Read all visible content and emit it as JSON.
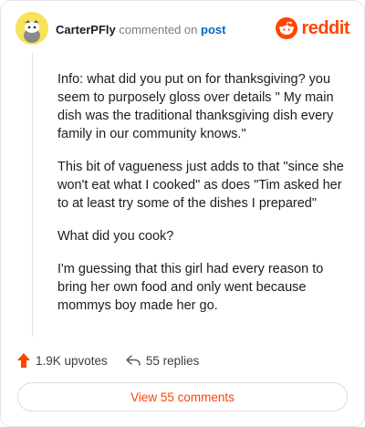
{
  "header": {
    "author": "CarterPFly",
    "action_text": "commented on",
    "post_link": "post",
    "brand": "reddit"
  },
  "comment": {
    "paragraphs": [
      "Info: what did you put on for thanksgiving? you seem to purposely gloss over details \" My main dish was the traditional thanksgiving dish every family in our community knows.\"",
      "This bit of vagueness just adds to that \"since she won't eat what I cooked\" as does \"Tim asked her to at least try some of the dishes I prepared\"",
      "What did you cook?",
      "I'm guessing that this girl had every reason to bring her own food and only went because mommys boy made her go."
    ]
  },
  "actions": {
    "upvotes": "1.9K upvotes",
    "replies": "55 replies"
  },
  "view_comments": "View 55 comments",
  "colors": {
    "accent": "#ff4500",
    "link": "#0a66c2",
    "avatar_bg": "#f6e35a"
  },
  "icons": {
    "upvote": "upvote-arrow-icon",
    "reply": "reply-arrow-icon",
    "logo": "reddit-snoo-icon"
  }
}
